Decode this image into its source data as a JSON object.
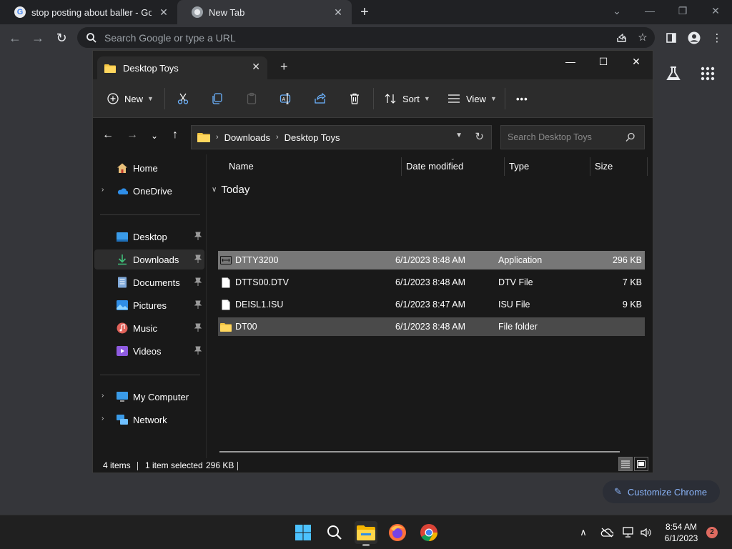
{
  "browser": {
    "tabs": [
      {
        "title": "stop posting about baller - Goog"
      },
      {
        "title": "New Tab"
      }
    ],
    "omnibox_placeholder": "Search Google or type a URL",
    "customize_label": "Customize Chrome"
  },
  "explorer": {
    "tab_title": "Desktop Toys",
    "commands": {
      "new": "New",
      "sort": "Sort",
      "view": "View",
      "more": "•••"
    },
    "breadcrumb": [
      "Downloads",
      "Desktop Toys"
    ],
    "search_placeholder": "Search Desktop Toys",
    "nav": {
      "home": "Home",
      "onedrive": "OneDrive",
      "desktop": "Desktop",
      "downloads": "Downloads",
      "documents": "Documents",
      "pictures": "Pictures",
      "music": "Music",
      "videos": "Videos",
      "mycomputer": "My Computer",
      "network": "Network"
    },
    "columns": {
      "name": "Name",
      "date": "Date modified",
      "type": "Type",
      "size": "Size"
    },
    "group": "Today",
    "files": [
      {
        "name": "DTTY3200",
        "date": "6/1/2023 8:48 AM",
        "type": "Application",
        "size": "296 KB"
      },
      {
        "name": "DTTS00.DTV",
        "date": "6/1/2023 8:48 AM",
        "type": "DTV File",
        "size": "7 KB"
      },
      {
        "name": "DEISL1.ISU",
        "date": "6/1/2023 8:47 AM",
        "type": "ISU File",
        "size": "9 KB"
      },
      {
        "name": "DT00",
        "date": "6/1/2023 8:48 AM",
        "type": "File folder",
        "size": ""
      }
    ],
    "status": {
      "items": "4 items",
      "selected": "1 item selected",
      "selected_size": "296 KB"
    }
  },
  "taskbar": {
    "time": "8:54 AM",
    "date": "6/1/2023",
    "notifications": "2"
  },
  "colors": {
    "accent": "#8ab4f8",
    "folder": "#f4c542",
    "selection": "#777777"
  }
}
